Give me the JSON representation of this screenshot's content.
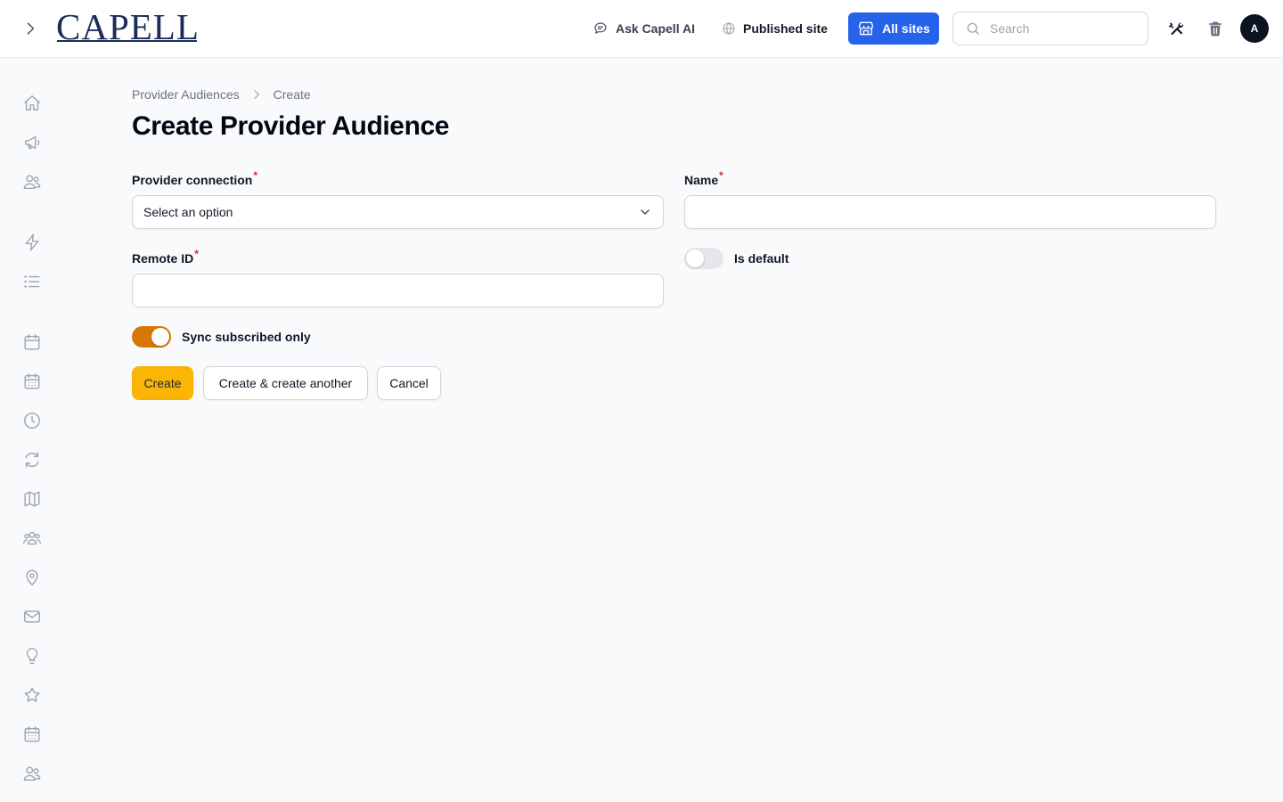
{
  "brand": {
    "logo_text": "CAPELL"
  },
  "header": {
    "ask_ai_label": "Ask Capell AI",
    "published_site_label": "Published site",
    "all_sites_label": "All sites",
    "search_placeholder": "Search",
    "avatar_initial": "A"
  },
  "sidebar": {
    "items": [
      {
        "icon": "home-icon"
      },
      {
        "icon": "megaphone-icon"
      },
      {
        "icon": "users-icon"
      },
      {
        "icon": "bolt-icon"
      },
      {
        "icon": "list-icon"
      },
      {
        "icon": "calendar-icon"
      },
      {
        "icon": "calendar-days-icon"
      },
      {
        "icon": "clock-icon"
      },
      {
        "icon": "refresh-icon"
      },
      {
        "icon": "map-icon"
      },
      {
        "icon": "user-group-icon"
      },
      {
        "icon": "map-pin-icon"
      },
      {
        "icon": "envelope-icon"
      },
      {
        "icon": "light-bulb-icon"
      },
      {
        "icon": "star-icon"
      },
      {
        "icon": "calendar-days-icon"
      },
      {
        "icon": "users-icon"
      }
    ]
  },
  "breadcrumb": {
    "parent": "Provider Audiences",
    "current": "Create"
  },
  "page": {
    "title": "Create Provider Audience"
  },
  "form": {
    "provider_connection": {
      "label": "Provider connection",
      "required_mark": "*",
      "value": "Select an option"
    },
    "name": {
      "label": "Name",
      "required_mark": "*",
      "value": ""
    },
    "remote_id": {
      "label": "Remote ID",
      "required_mark": "*",
      "value": ""
    },
    "is_default": {
      "label": "Is default",
      "checked": false
    },
    "sync_subscribed_only": {
      "label": "Sync subscribed only",
      "checked": true
    }
  },
  "actions": {
    "create_label": "Create",
    "create_another_label": "Create & create another",
    "cancel_label": "Cancel"
  },
  "colors": {
    "primary_button": "#fbb506",
    "all_sites_button": "#2563eb",
    "toggle_on": "#d97706",
    "required": "#dc2626"
  }
}
